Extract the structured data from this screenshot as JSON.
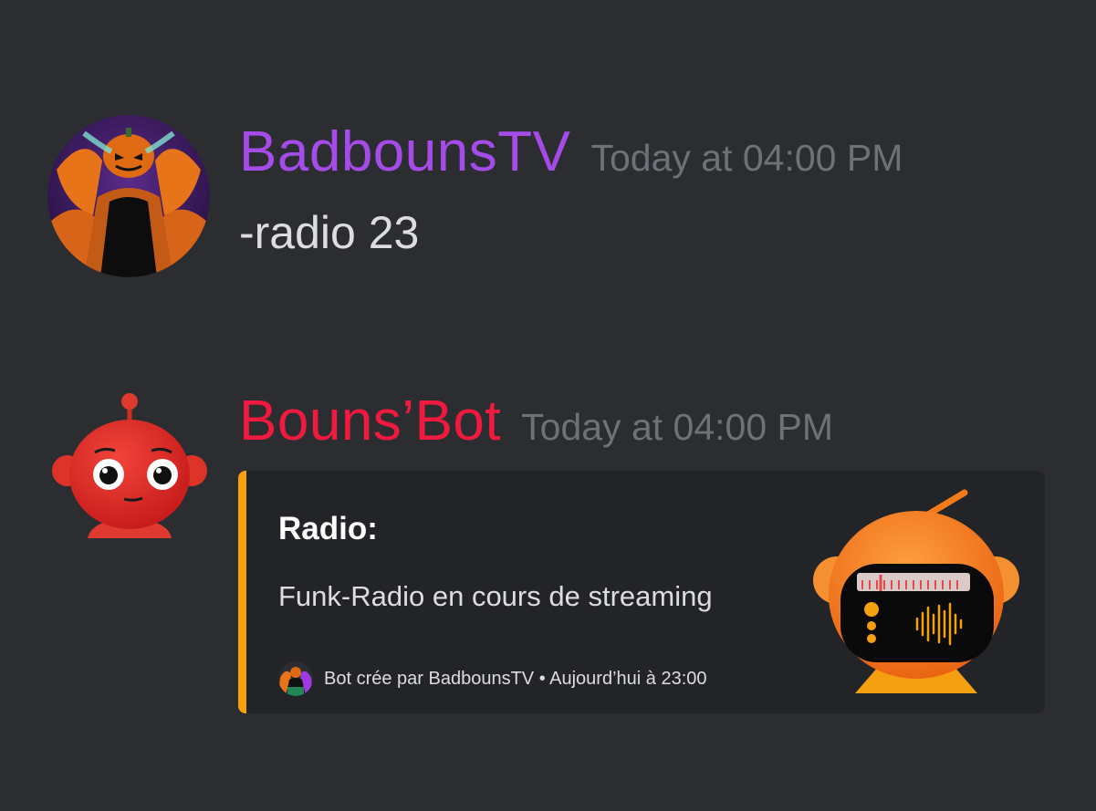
{
  "messages": [
    {
      "author": "BadbounsTV",
      "author_color": "#a44be8",
      "timestamp": "Today at 04:00 PM",
      "content": "-radio 23",
      "avatar_icon": "user-avatar-pumpkin"
    },
    {
      "author": "Bouns’Bot",
      "author_color": "#f0193f",
      "timestamp": "Today at 04:00 PM",
      "avatar_icon": "robot-avatar",
      "embed": {
        "accent_color": "#f5a011",
        "title": "Radio:",
        "description": "Funk-Radio en cours de streaming",
        "footer_text": "Bot crée par BadbounsTV • Aujourd’hui à 23:00",
        "footer_icon": "author-avatar-icon",
        "thumbnail_icon": "radio-icon"
      }
    }
  ]
}
